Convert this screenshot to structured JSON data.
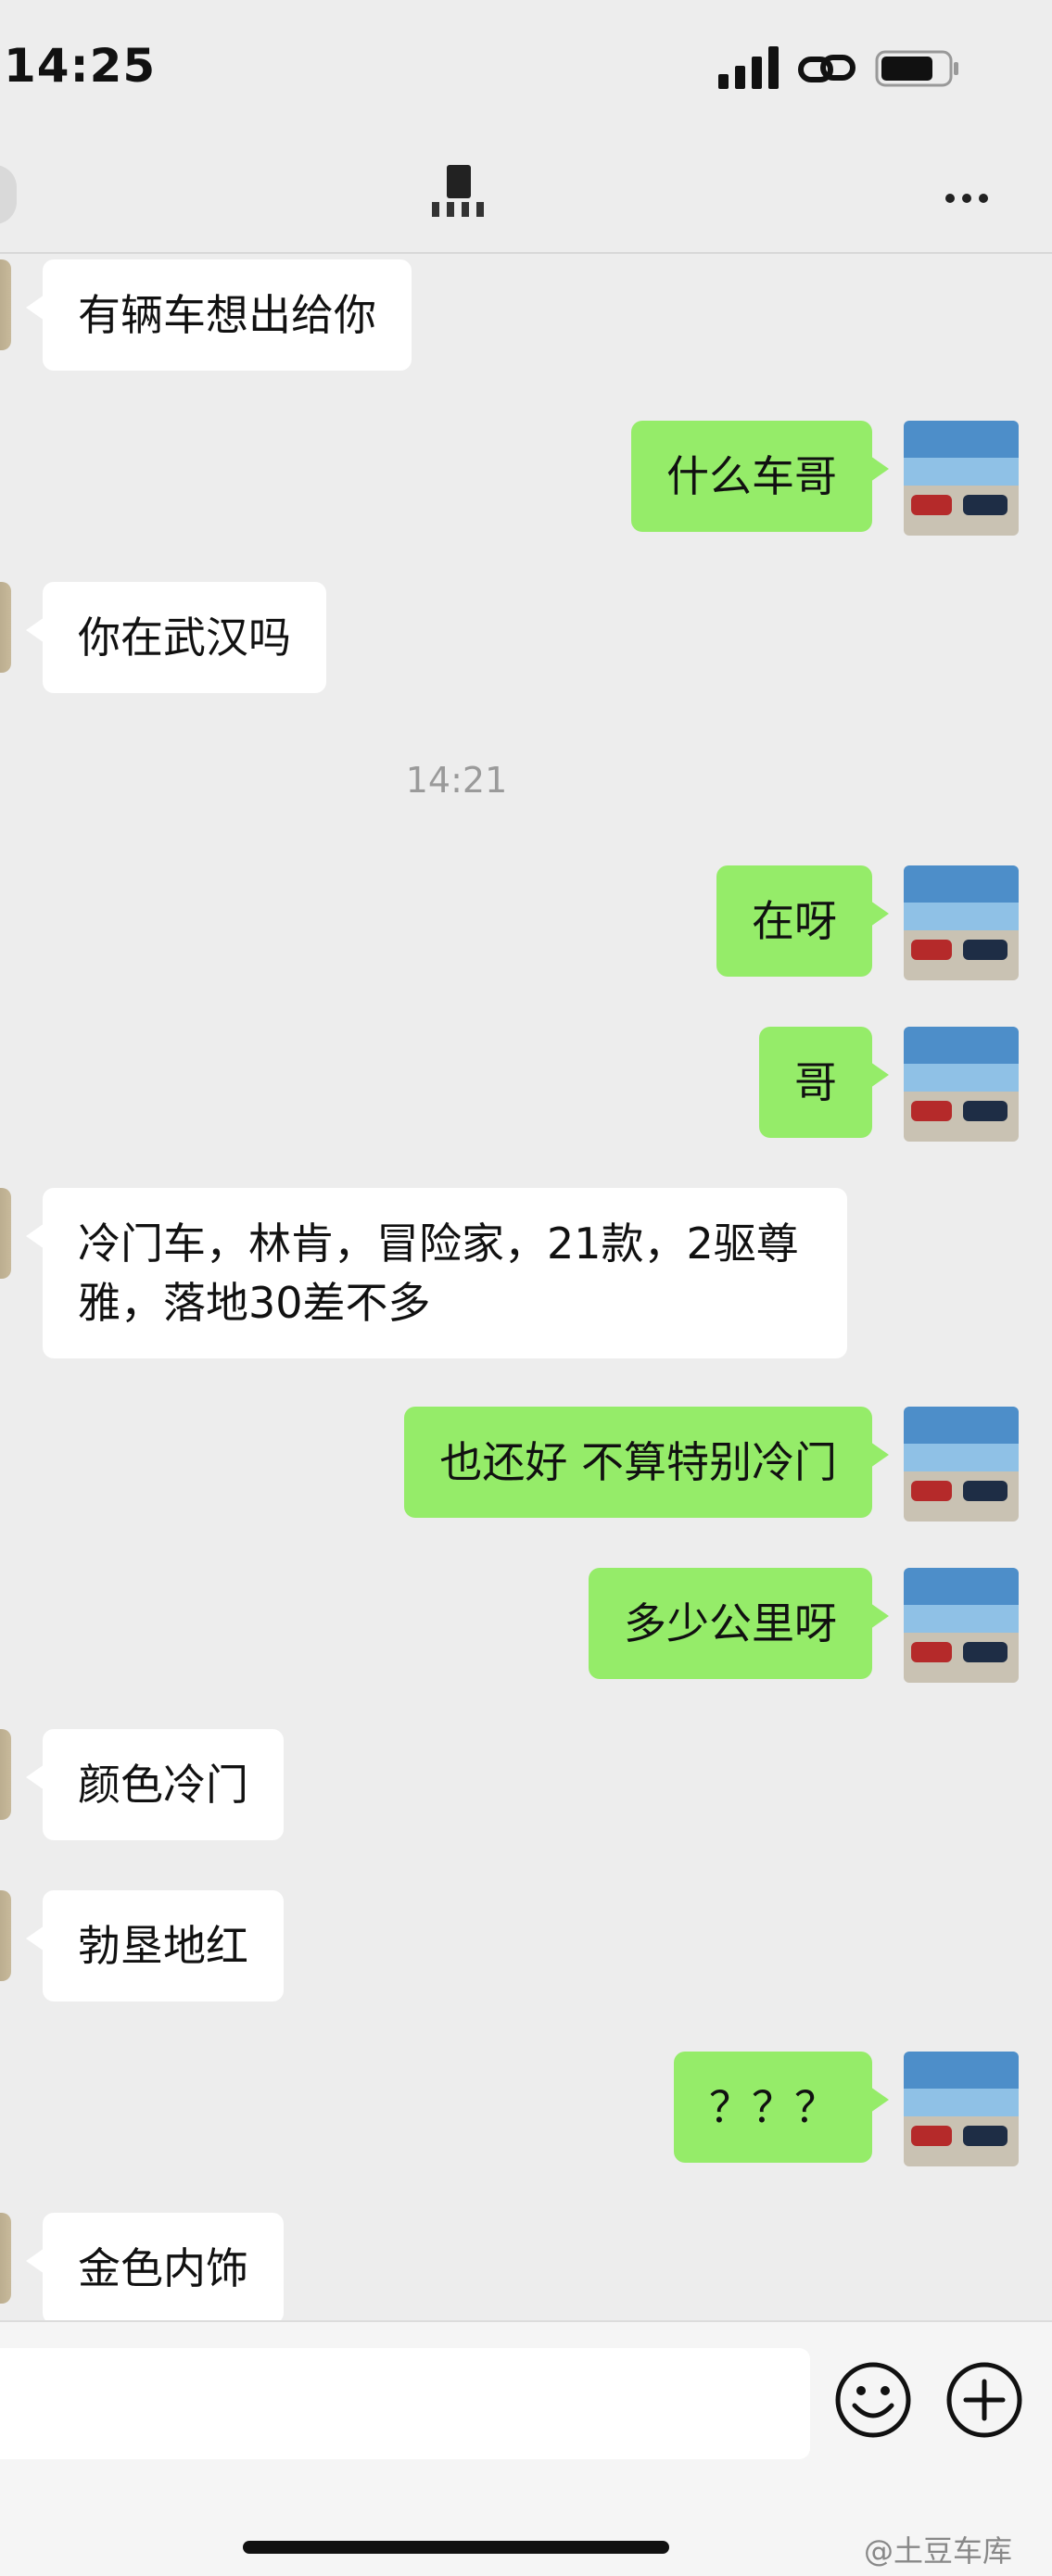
{
  "status_bar": {
    "time": "14:25"
  },
  "header": {
    "title": ""
  },
  "chat": {
    "timestamp": "14:21",
    "messages": [
      {
        "side": "in",
        "text": "有辆车想出给你"
      },
      {
        "side": "out",
        "text": "什么车哥"
      },
      {
        "side": "in",
        "text": "你在武汉吗"
      },
      {
        "side": "out",
        "text": "在呀"
      },
      {
        "side": "out",
        "text": "哥"
      },
      {
        "side": "in",
        "text": "冷门车，林肯，冒险家，21款，2驱尊雅，落地30差不多"
      },
      {
        "side": "out",
        "text": "也还好 不算特别冷门"
      },
      {
        "side": "out",
        "text": "多少公里呀"
      },
      {
        "side": "in",
        "text": "颜色冷门"
      },
      {
        "side": "in",
        "text": "勃垦地红"
      },
      {
        "side": "out",
        "text": "？？？"
      },
      {
        "side": "in",
        "text": "金色内饰"
      }
    ]
  },
  "input": {
    "placeholder": ""
  },
  "watermark": "@土豆车库",
  "colors": {
    "background": "#ededed",
    "outgoing": "#95ec69",
    "incoming": "#ffffff"
  },
  "icons": [
    "signal-icon",
    "link-icon",
    "battery-icon",
    "more-icon",
    "emoji-icon",
    "plus-icon"
  ]
}
